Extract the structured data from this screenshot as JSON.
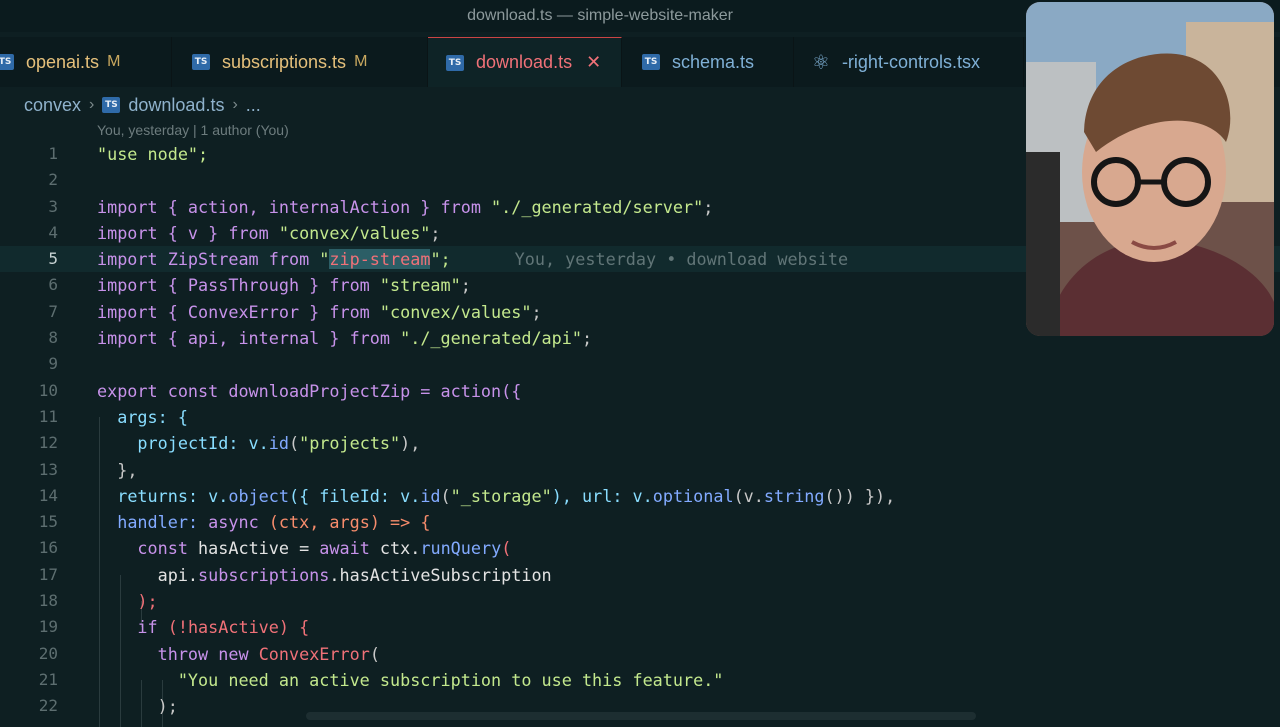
{
  "window": {
    "title": "download.ts — simple-website-maker"
  },
  "tabs": [
    {
      "name": "openai.ts",
      "badge": "M",
      "icon": "typescript-icon"
    },
    {
      "name": "subscriptions.ts",
      "badge": "M",
      "icon": "typescript-icon"
    },
    {
      "name": "download.ts",
      "badge": "",
      "icon": "typescript-icon",
      "active": true
    },
    {
      "name": "schema.ts",
      "badge": "",
      "icon": "typescript-icon"
    },
    {
      "name": "-right-controls.tsx",
      "badge": "",
      "icon": "react-icon"
    }
  ],
  "breadcrumb": {
    "folder": "convex",
    "file": "download.ts",
    "more": "..."
  },
  "blame": {
    "header": "You, yesterday | 1 author (You)",
    "inline": "You, yesterday • download website"
  },
  "code": {
    "line_numbers": [
      "1",
      "2",
      "3",
      "4",
      "5",
      "6",
      "7",
      "8",
      "9",
      "10",
      "11",
      "12",
      "13",
      "14",
      "15",
      "16",
      "17",
      "18",
      "19",
      "20",
      "21",
      "22"
    ],
    "current_line": 5,
    "l1": "\"use node\";",
    "l3a": "import { action, internalAction } from ",
    "l3b": "\"./_generated/server\"",
    "l4a": "import { v } from ",
    "l4b": "\"convex/values\"",
    "l5a": "import ZipStream from ",
    "l5q": "\"",
    "l5sel": "zip-stream",
    "l5b": "\";",
    "l6a": "import { PassThrough } from ",
    "l6b": "\"stream\"",
    "l7a": "import { ConvexError } from ",
    "l7b": "\"convex/values\"",
    "l8a": "import { api, internal } from ",
    "l8b": "\"./_generated/api\"",
    "l10": "export const downloadProjectZip = action({",
    "l11": "args: {",
    "l12a": "projectId: v.",
    "l12b": "id",
    "l12c": "(",
    "l12d": "\"projects\"",
    "l12e": "),",
    "l13": "},",
    "l14a": "returns: v.",
    "l14b": "object",
    "l14c": "({ fileId: v.",
    "l14d": "id",
    "l14e": "(",
    "l14f": "\"_storage\"",
    "l14g": "), url: v.",
    "l14h": "optional",
    "l14i": "(v.",
    "l14j": "string",
    "l14k": "()) }),",
    "l15a": "handler: ",
    "l15b": "async",
    "l15c": " (ctx, args) => {",
    "l16a": "const",
    "l16b": " hasActive = ",
    "l16c": "await",
    "l16d": " ctx.",
    "l16e": "runQuery",
    "l16f": "(",
    "l17a": "api.",
    "l17b": "subscriptions",
    "l17c": ".hasActiveSubscription",
    "l18": ");",
    "l19a": "if",
    "l19b": " (!hasActive) {",
    "l20a": "throw",
    "l20b": " new ",
    "l20c": "ConvexError",
    "l20d": "(",
    "l21": "\"You need an active subscription to use this feature.\"",
    "l22": ");"
  },
  "colors": {
    "background": "#0e1f22",
    "keyword": "#c792ea",
    "string": "#c3e88d",
    "function": "#82aaff",
    "selection": "#2c5e66"
  }
}
